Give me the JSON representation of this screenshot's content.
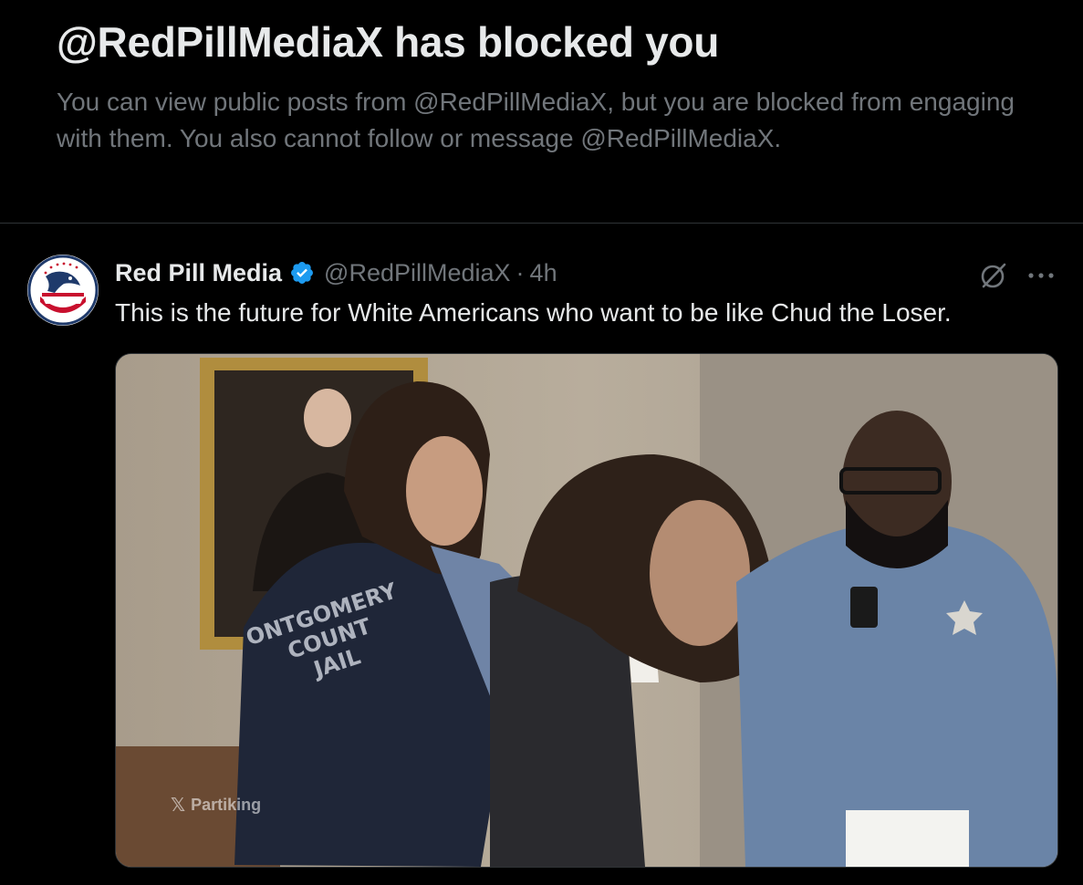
{
  "blocked_notice": {
    "title": "@RedPillMediaX has blocked you",
    "description": "You can view public posts from @RedPillMediaX, but you are blocked from engaging with them. You also cannot follow or message @RedPillMediaX."
  },
  "post": {
    "display_name": "Red Pill Media",
    "verified": true,
    "handle": "@RedPillMediaX",
    "separator": "·",
    "time": "4h",
    "text": "This is the future for White Americans who want to be like Chud the Loser.",
    "icons": [
      "avatar-eagle-flag",
      "verified-badge-icon",
      "grok-icon",
      "more-icon"
    ],
    "media": {
      "watermark": "Partiking",
      "shirt_text": [
        "ONTGOMERY",
        "COUNT",
        "JAIL"
      ]
    }
  },
  "colors": {
    "background": "#000000",
    "primary_text": "#e7e9ea",
    "secondary_text": "#71767b",
    "divider": "#2f3336",
    "verified_blue": "#1d9bf0"
  }
}
